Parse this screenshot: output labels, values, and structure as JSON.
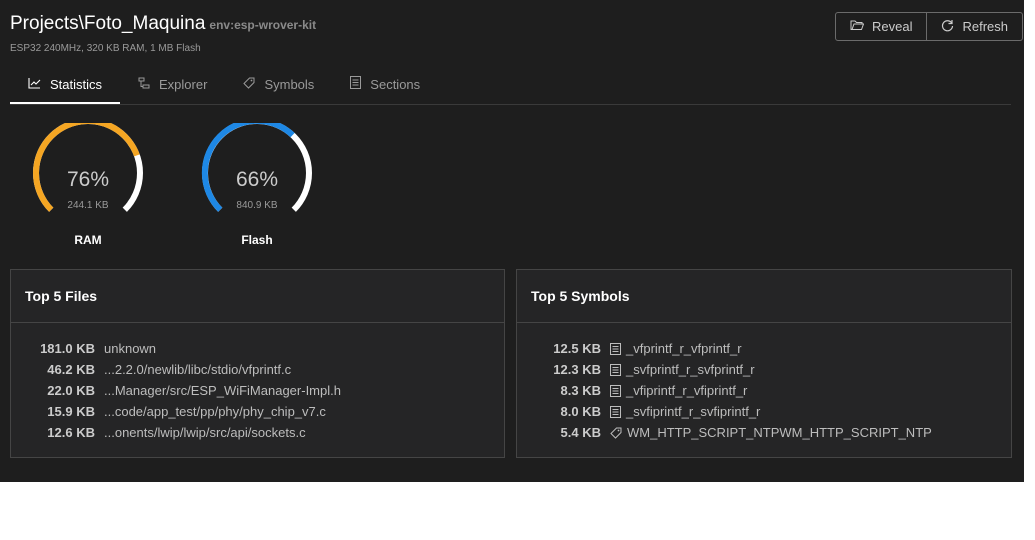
{
  "header": {
    "title": "Projects\\Foto_Maquina",
    "env": "env:esp-wrover-kit",
    "subtitle": "ESP32 240MHz, 320 KB RAM, 1 MB Flash",
    "reveal_label": "Reveal",
    "refresh_label": "Refresh"
  },
  "tabs": [
    {
      "label": "Statistics",
      "icon": "chart-line-icon",
      "active": true
    },
    {
      "label": "Explorer",
      "icon": "tree-icon",
      "active": false
    },
    {
      "label": "Symbols",
      "icon": "tag-icon",
      "active": false
    },
    {
      "label": "Sections",
      "icon": "list-icon",
      "active": false
    }
  ],
  "gauges": {
    "ram": {
      "percent": "76%",
      "fraction": 0.76,
      "size": "244.1 KB",
      "label": "RAM",
      "color": "#f5a623"
    },
    "flash": {
      "percent": "66%",
      "fraction": 0.66,
      "size": "840.9 KB",
      "label": "Flash",
      "color": "#1e88e5"
    }
  },
  "top_files": {
    "title": "Top 5 Files",
    "rows": [
      {
        "size": "181.0 KB",
        "name": "unknown"
      },
      {
        "size": "46.2 KB",
        "name": "...2.2.0/newlib/libc/stdio/vfprintf.c"
      },
      {
        "size": "22.0 KB",
        "name": "...Manager/src/ESP_WiFiManager-Impl.h"
      },
      {
        "size": "15.9 KB",
        "name": "...code/app_test/pp/phy/phy_chip_v7.c"
      },
      {
        "size": "12.6 KB",
        "name": "...onents/lwip/lwip/src/api/sockets.c"
      }
    ]
  },
  "top_symbols": {
    "title": "Top 5 Symbols",
    "rows": [
      {
        "size": "12.5 KB",
        "name": "_vfprintf_r_vfprintf_r",
        "icon": "function-icon"
      },
      {
        "size": "12.3 KB",
        "name": "_svfprintf_r_svfprintf_r",
        "icon": "function-icon"
      },
      {
        "size": "8.3 KB",
        "name": "_vfiprintf_r_vfiprintf_r",
        "icon": "function-icon"
      },
      {
        "size": "8.0 KB",
        "name": "_svfiprintf_r_svfiprintf_r",
        "icon": "function-icon"
      },
      {
        "size": "5.4 KB",
        "name": "WM_HTTP_SCRIPT_NTPWM_HTTP_SCRIPT_NTP",
        "icon": "tag-icon"
      }
    ]
  },
  "colors": {
    "background": "#1e1e1e",
    "panel": "#252526",
    "ram": "#f5a623",
    "flash": "#1e88e5"
  }
}
